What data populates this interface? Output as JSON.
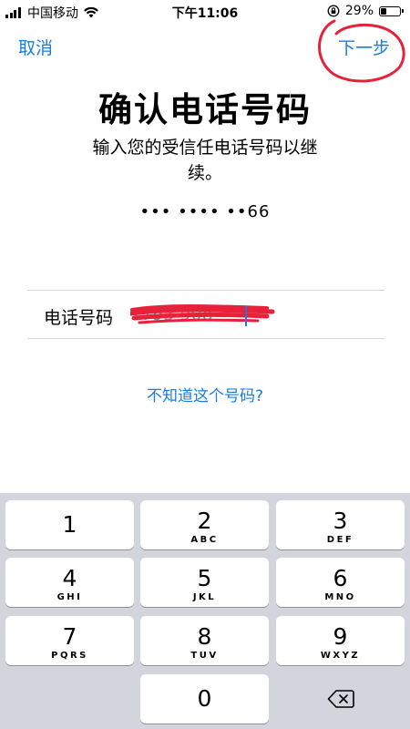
{
  "status_bar": {
    "carrier": "中国移动",
    "time": "下午11:06",
    "battery_percent": "29%",
    "battery_level": 0.29
  },
  "nav": {
    "cancel_label": "取消",
    "next_label": "下一步"
  },
  "main": {
    "title": "确认电话号码",
    "subtitle": "输入您的受信任电话号码以继续。",
    "masked_number": "••• •••• ••66",
    "phone_field_label": "电话号码",
    "phone_value": "1795     908",
    "help_link": "不知道这个号码?"
  },
  "keypad": {
    "keys": [
      {
        "digit": "1",
        "letters": ""
      },
      {
        "digit": "2",
        "letters": "ABC"
      },
      {
        "digit": "3",
        "letters": "DEF"
      },
      {
        "digit": "4",
        "letters": "GHI"
      },
      {
        "digit": "5",
        "letters": "JKL"
      },
      {
        "digit": "6",
        "letters": "MNO"
      },
      {
        "digit": "7",
        "letters": "PQRS"
      },
      {
        "digit": "8",
        "letters": "TUV"
      },
      {
        "digit": "9",
        "letters": "WXYZ"
      },
      {
        "digit": "0",
        "letters": ""
      }
    ]
  },
  "colors": {
    "accent": "#1a7ce0",
    "annotation_red": "#e8213a",
    "keypad_bg": "#d2d5db"
  }
}
